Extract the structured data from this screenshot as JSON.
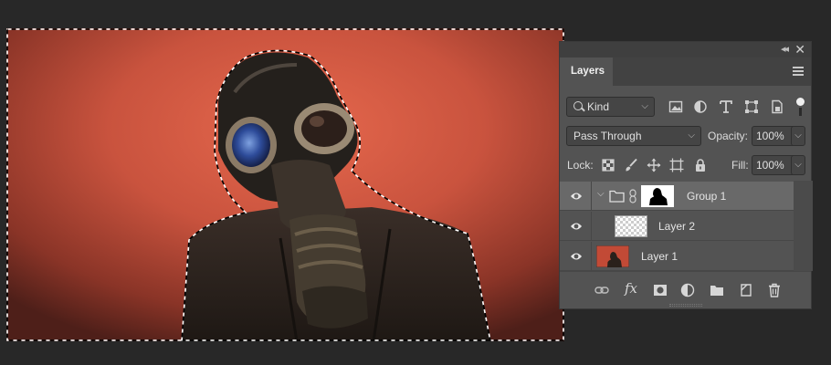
{
  "panel": {
    "tab_label": "Layers",
    "filter": {
      "kind_label": "Kind"
    },
    "blend_mode": "Pass Through",
    "opacity": {
      "label": "Opacity:",
      "value": "100%"
    },
    "lock": {
      "label": "Lock:"
    },
    "fill": {
      "label": "Fill:",
      "value": "100%"
    },
    "layers": [
      {
        "name": "Group 1",
        "type": "group",
        "visible": true,
        "selected": true
      },
      {
        "name": "Layer 2",
        "type": "transparent",
        "visible": true,
        "selected": false
      },
      {
        "name": "Layer 1",
        "type": "photo",
        "visible": true,
        "selected": false
      }
    ]
  },
  "colors": {
    "workspace": "#282828",
    "panel": "#535353",
    "selected_row": "#696969",
    "backdrop_red": "#c9533e"
  }
}
